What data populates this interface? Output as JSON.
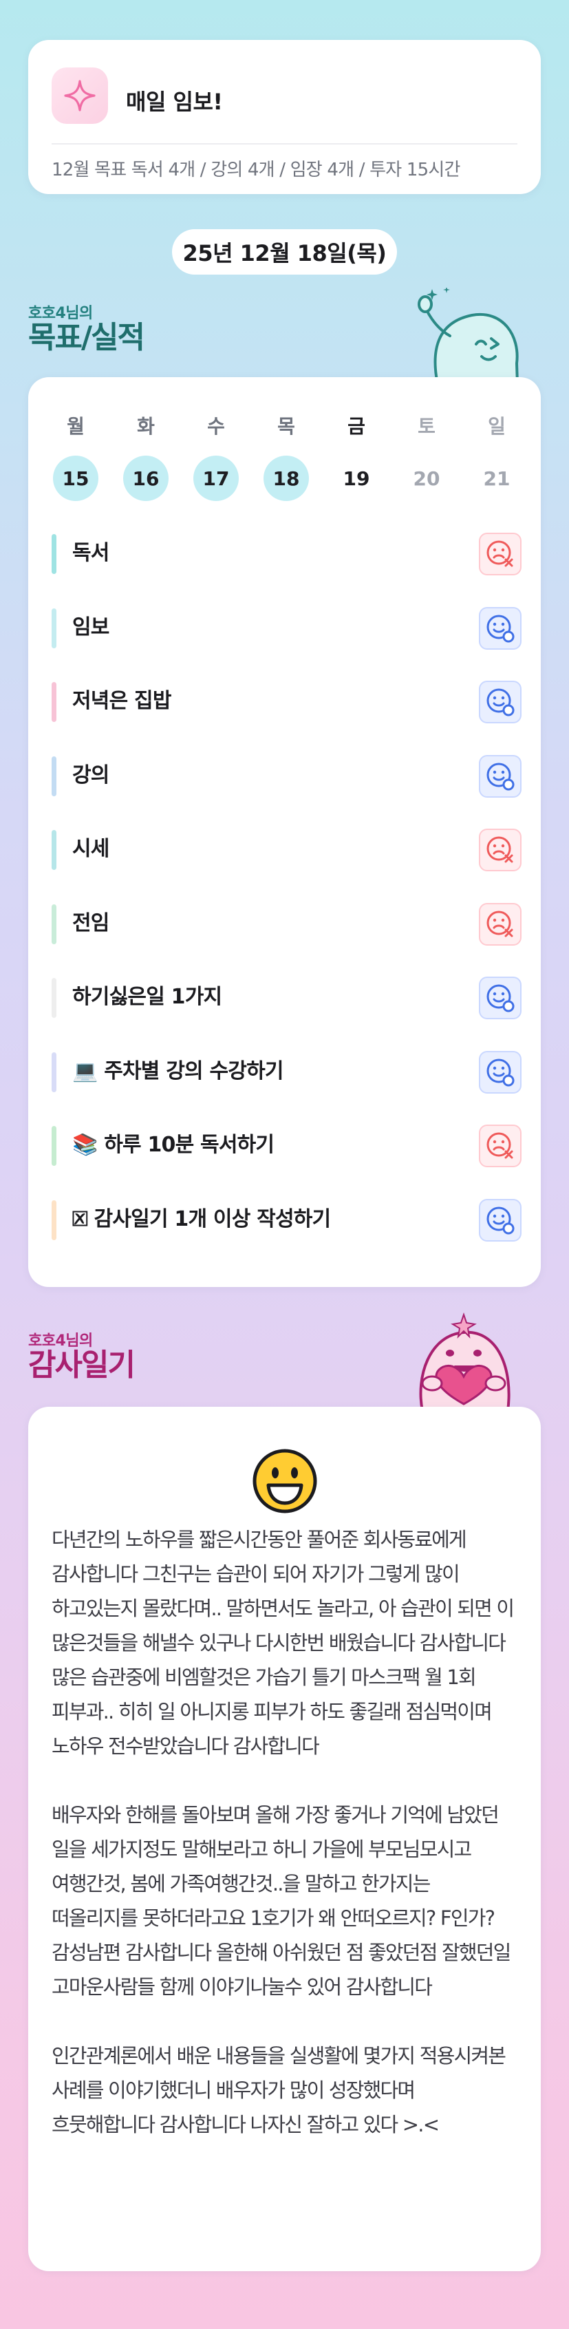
{
  "header": {
    "title": "매일 임보!",
    "goal_summary": "12월 목표  독서 4개 / 강의 4개 / 임장 4개 / 투자 15시간",
    "icon": "sparkle-icon"
  },
  "date": "25년 12월 18일(목)",
  "goal_section": {
    "subtitle": "호호4님의",
    "title": "목표/실적"
  },
  "week": [
    {
      "day": "월",
      "num": "15",
      "state": "past"
    },
    {
      "day": "화",
      "num": "16",
      "state": "past"
    },
    {
      "day": "수",
      "num": "17",
      "state": "past"
    },
    {
      "day": "목",
      "num": "18",
      "state": "past"
    },
    {
      "day": "금",
      "num": "19",
      "state": "today"
    },
    {
      "day": "토",
      "num": "20",
      "state": "future"
    },
    {
      "day": "일",
      "num": "21",
      "state": "future"
    }
  ],
  "goals": [
    {
      "label": "독서",
      "status": "fail",
      "bar_color": "#9fe3e3"
    },
    {
      "label": "임보",
      "status": "success",
      "bar_color": "#c4ecf0"
    },
    {
      "label": "저녁은 집밥",
      "status": "success",
      "bar_color": "#f7c3d6"
    },
    {
      "label": "강의",
      "status": "success",
      "bar_color": "#c3dcf3"
    },
    {
      "label": "시세",
      "status": "fail",
      "bar_color": "#b6e6e9"
    },
    {
      "label": "전임",
      "status": "fail",
      "bar_color": "#c9ecd9"
    },
    {
      "label": "하기싫은일 1가지",
      "status": "success",
      "bar_color": "#eeeeee"
    },
    {
      "label": "💻 주차별 강의 수강하기",
      "status": "success",
      "bar_color": "#d8dcf7"
    },
    {
      "label": "📚 하루 10분 독서하기",
      "status": "fail",
      "bar_color": "#c6ecd0"
    },
    {
      "label": "🗵 감사일기 1개 이상 작성하기",
      "status": "success",
      "bar_color": "#fde2c6"
    }
  ],
  "thanks_section": {
    "subtitle": "호호4님의",
    "title": "감사일기",
    "emoji": "smiley-icon",
    "paragraphs": [
      "다년간의 노하우를 짧은시간동안 풀어준 회사동료에게 감사합니다 그친구는 습관이 되어 자기가 그렇게 많이 하고있는지 몰랐다며.. 말하면서도 놀라고, 아 습관이 되면 이 많은것들을 해낼수 있구나 다시한번 배웠습니다 감사합니다 많은 습관중에 비엠할것은 가습기 틀기 마스크팩 월 1회 피부과.. 히히 일 아니지롱 피부가 하도 좋길래 점심먹이며 노하우 전수받았습니다 감사합니다",
      "배우자와 한해를 돌아보며 올해 가장 좋거나 기억에 남았던 일을 세가지정도 말해보라고 하니 가을에 부모님모시고 여행간것, 봄에 가족여행간것..을 말하고 한가지는 떠올리지를 못하더라고요 1호기가 왜 안떠오르지? F인가? 감성남편 감사합니다 올한해 아쉬웠던 점 좋았던점 잘했던일 고마운사람들 함께 이야기나눌수 있어 감사합니다",
      "인간관계론에서 배운 내용들을 실생활에 몇가지 적용시켜본 사례를 이야기했더니 배우자가 많이 성장했다며 흐뭇해합니다 감사합니다 나자신 잘하고 있다 >.<"
    ]
  },
  "colors": {
    "past_day_circle": "#c3eef4",
    "success_icon": "#3f6fe6",
    "fail_icon": "#ef5a5a",
    "goal_heading": "#1f6e6c",
    "thanks_heading": "#a8206f"
  }
}
